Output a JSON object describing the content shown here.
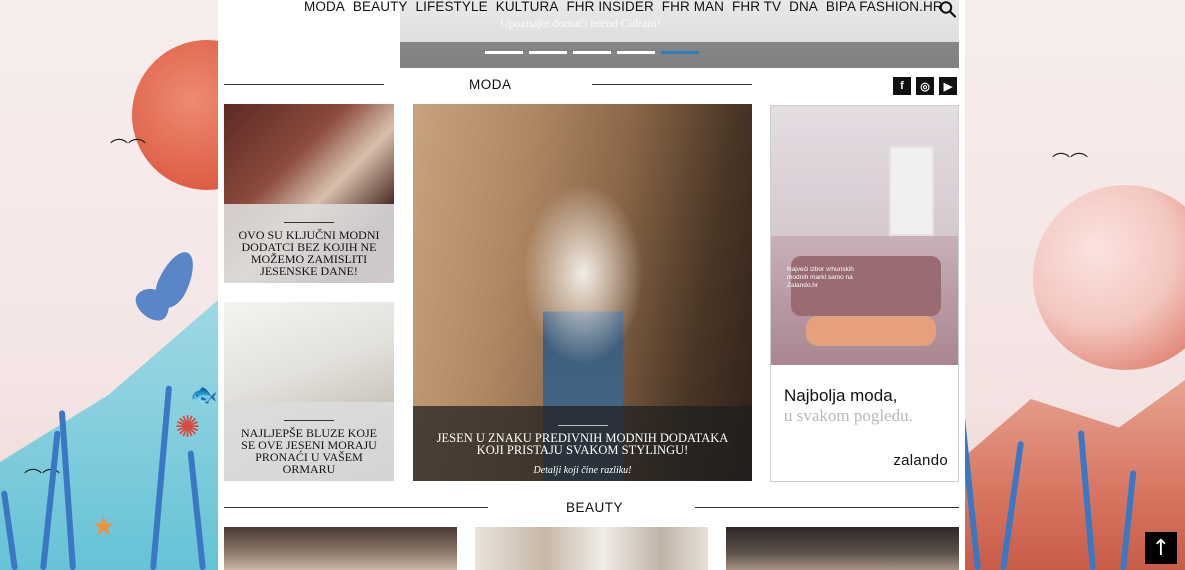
{
  "nav": {
    "items": [
      "MODA",
      "BEAUTY",
      "LIFESTYLE",
      "KULTURA",
      "FHR INSIDER",
      "FHR MAN",
      "FHR TV",
      "DNA",
      "BIPA FASHION.HR"
    ]
  },
  "slider": {
    "caption": "Upoznajte domaći brend Cidrani!",
    "active_dot": 5,
    "dot_count": 5
  },
  "sections": {
    "moda": "MODA",
    "beauty": "BEAUTY"
  },
  "social": {
    "facebook": "f",
    "instagram": "◎",
    "youtube": "▶"
  },
  "moda_articles": [
    {
      "title": "OVO SU KLJUČNI MODNI DODATCI BEZ KOJIH NE MOŽEMO ZAMISLITI JESENSKE DANE!"
    },
    {
      "title": "NAJLJEPŠE BLUZE KOJE SE OVE JESENI MORAJU PRONAĆI U VAŠEM ORMARU"
    }
  ],
  "feature": {
    "title": "JESEN U ZNAKU PREDIVNIH MODNIH DODATAKA KOJI PRISTAJU SVAKOM STYLINGU!",
    "subtitle": "Detalji koji čine razliku!"
  },
  "ad": {
    "small_text": "Najveći izbor vrhunskih modnih marki samo na Zalando.hr",
    "headline": "Najbolja moda,",
    "sub": "u svakom pogledu.",
    "brand": "zalando"
  },
  "scroll_top": "↑",
  "colors": {
    "accent": "#2e7fc1",
    "caption_bg": "#dcdcdc",
    "feature_bg": "#1e1e1e"
  }
}
